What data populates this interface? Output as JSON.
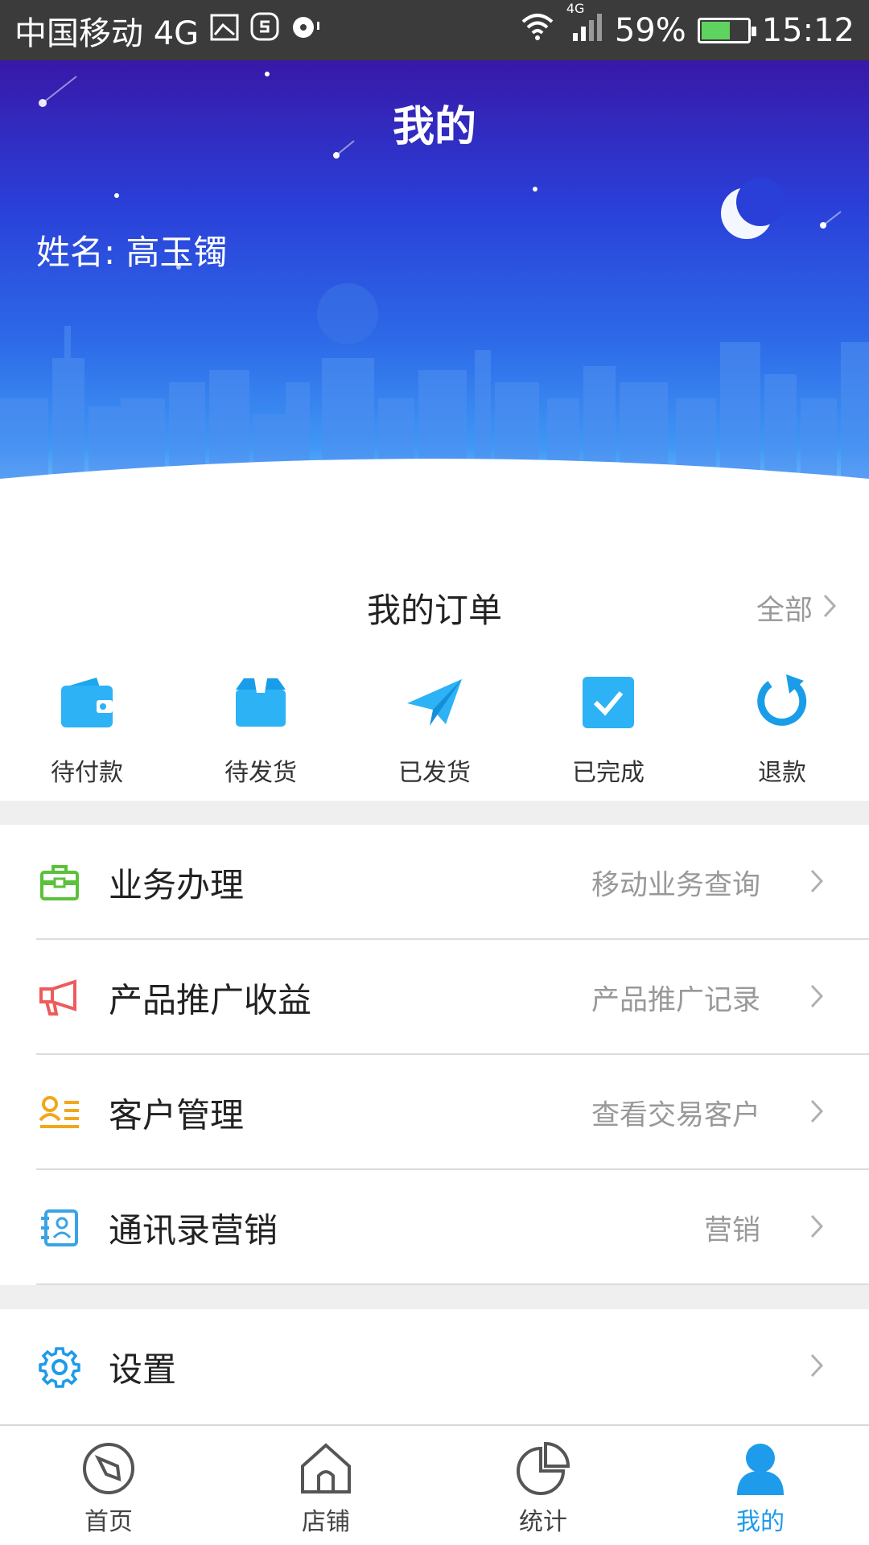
{
  "status_bar": {
    "carrier": "中国移动 4G",
    "network_badge": "4G",
    "battery_percent": "59%",
    "battery_level": 0.59,
    "time": "15:12"
  },
  "header": {
    "title": "我的",
    "user_name": "姓名: 高玉镯"
  },
  "orders": {
    "title": "我的订单",
    "all_label": "全部",
    "items": [
      {
        "label": "待付款",
        "icon": "wallet-icon"
      },
      {
        "label": "待发货",
        "icon": "box-icon"
      },
      {
        "label": "已发货",
        "icon": "paper-plane-icon"
      },
      {
        "label": "已完成",
        "icon": "check-square-icon"
      },
      {
        "label": "退款",
        "icon": "refund-icon"
      }
    ]
  },
  "menu": [
    {
      "label": "业务办理",
      "sub": "移动业务查询",
      "icon": "briefcase-icon"
    },
    {
      "label": "产品推广收益",
      "sub": "产品推广记录",
      "icon": "megaphone-icon"
    },
    {
      "label": "客户管理",
      "sub": "查看交易客户",
      "icon": "customer-list-icon"
    },
    {
      "label": "通讯录营销",
      "sub": "营销",
      "icon": "contacts-icon"
    }
  ],
  "settings": {
    "label": "设置",
    "icon": "gear-icon"
  },
  "tab_bar": {
    "items": [
      {
        "label": "首页",
        "icon": "compass-icon"
      },
      {
        "label": "店铺",
        "icon": "house-icon"
      },
      {
        "label": "统计",
        "icon": "pie-chart-icon"
      },
      {
        "label": "我的",
        "icon": "person-icon",
        "active": true
      }
    ]
  },
  "colors": {
    "accent": "#1e9bea",
    "hero_top": "#3818a8",
    "hero_mid": "#2d6be8"
  }
}
